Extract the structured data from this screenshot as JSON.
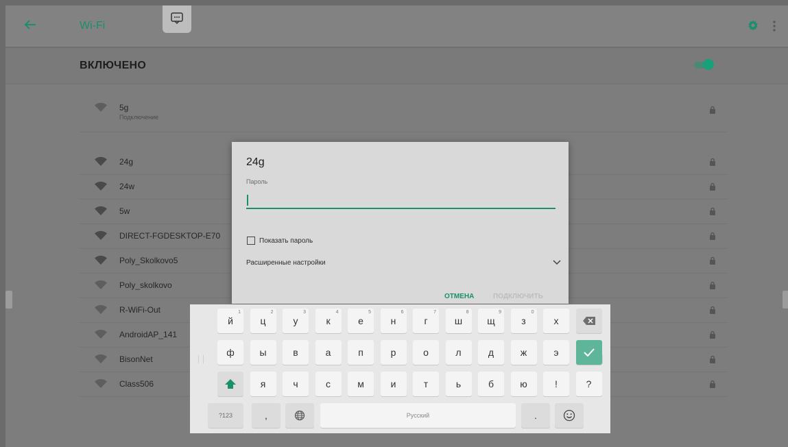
{
  "appbar": {
    "title": "Wi-Fi"
  },
  "wifi_state": {
    "label": "ВКЛЮЧЕНО",
    "enabled": true
  },
  "networks": [
    {
      "name": "5g",
      "status": "Подключение"
    },
    {
      "name": "24g"
    },
    {
      "name": "24w"
    },
    {
      "name": "5w"
    },
    {
      "name": "DIRECT-FGDESKTOP-E70"
    },
    {
      "name": "Poly_Skolkovo5"
    },
    {
      "name": "Poly_skolkovo"
    },
    {
      "name": "R-WiFi-Out"
    },
    {
      "name": "AndroidAP_141"
    },
    {
      "name": "BisonNet"
    },
    {
      "name": "Class506"
    }
  ],
  "dialog": {
    "title": "24g",
    "password_label": "Пароль",
    "password_value": "",
    "show_password_label": "Показать пароль",
    "advanced_label": "Расширенные настройки",
    "cancel_label": "ОТМЕНА",
    "connect_label": "ПОДКЛЮЧИТЬ"
  },
  "keyboard": {
    "row1": [
      {
        "k": "й",
        "h": "1"
      },
      {
        "k": "ц",
        "h": "2"
      },
      {
        "k": "у",
        "h": "3"
      },
      {
        "k": "к",
        "h": "4"
      },
      {
        "k": "е",
        "h": "5"
      },
      {
        "k": "н",
        "h": "6"
      },
      {
        "k": "г",
        "h": "7"
      },
      {
        "k": "ш",
        "h": "8"
      },
      {
        "k": "щ",
        "h": "9"
      },
      {
        "k": "з",
        "h": "0"
      },
      {
        "k": "х",
        "h": ""
      }
    ],
    "row2": [
      "ф",
      "ы",
      "в",
      "а",
      "п",
      "р",
      "о",
      "л",
      "д",
      "ж",
      "э"
    ],
    "row3": [
      "я",
      "ч",
      "с",
      "м",
      "и",
      "т",
      "ь",
      "б",
      "ю",
      "!",
      "?"
    ],
    "symbols_label": "?123",
    "comma": ",",
    "space_label": "Русский",
    "period": "."
  },
  "colors": {
    "accent": "#1a8f6d",
    "enter_key": "#5fb59a"
  }
}
